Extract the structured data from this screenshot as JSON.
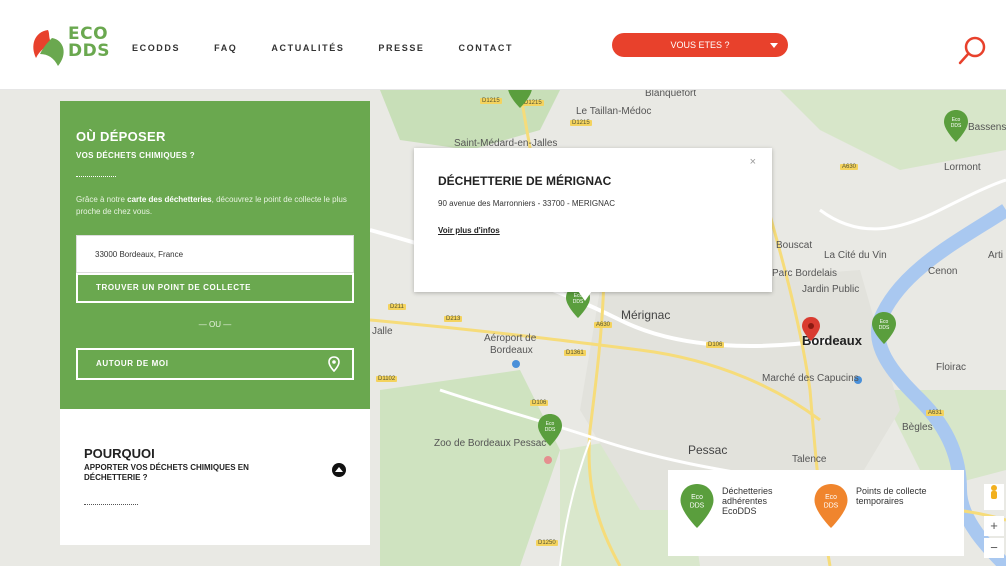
{
  "header": {
    "logo": {
      "line1": "ECO",
      "line2": "DDS",
      "green": "#6aa84f",
      "red": "#e8412c"
    },
    "nav": [
      "ECODDS",
      "FAQ",
      "ACTUALITÉS",
      "PRESSE",
      "CONTACT"
    ],
    "vous_etes": "VOUS ETES ?",
    "search_icon": "search-icon"
  },
  "panel": {
    "title": "OÙ DÉPOSER",
    "subtitle": "VOS DÉCHETS CHIMIQUES ?",
    "desc_before": "Grâce à notre ",
    "desc_bold": "carte des déchetteries",
    "desc_after": ", découvrez le point de collecte le plus proche de chez vous.",
    "address_value": "33000 Bordeaux, France",
    "find_button": "TROUVER UN POINT DE COLLECTE",
    "or_text": "— OU —",
    "near_button": "AUTOUR DE MOI"
  },
  "why": {
    "title": "POURQUOI",
    "subtitle": "APPORTER VOS DÉCHETS CHIMIQUES EN DÉCHETTERIE ?"
  },
  "popup": {
    "title": "DÉCHETTERIE DE MÉRIGNAC",
    "address": "90 avenue des Marronniers - 33700 - MERIGNAC",
    "link": "Voir plus d'infos",
    "close": "×"
  },
  "map": {
    "pin_label_line1": "Eco",
    "pin_label_line2": "DDS",
    "places": {
      "blanquefort": "Blanquefort",
      "taillan": "Le Taillan-Médoc",
      "saint_medard": "Saint-Médard-en-Jalles",
      "merignac": "Mérignac",
      "aeroport1": "Aéroport de",
      "aeroport2": "Bordeaux",
      "zoo": "Zoo de Bordeaux Pessac",
      "pessac": "Pessac",
      "talence": "Talence",
      "bordeaux": "Bordeaux",
      "bouscat": "Bouscat",
      "cite_vin": "La Cité du Vin",
      "parc": "Parc Bordelais",
      "jardin": "Jardin Public",
      "marche": "Marché des Capucins",
      "lormont": "Lormont",
      "cenon": "Cenon",
      "floirac": "Floirac",
      "begles": "Bègles",
      "bassens": "Bassens",
      "arti": "Arti",
      "jalle": "Jalle"
    },
    "roads": [
      "D1215",
      "D1215",
      "D1215",
      "D211",
      "D213",
      "A630",
      "D106",
      "D1361",
      "D106",
      "D1102",
      "D1250",
      "A630",
      "A631"
    ]
  },
  "legend": {
    "item1": "Déchetteries adhérentes EcoDDS",
    "item2": "Points de collecte temporaires",
    "green": "#5a9e3d",
    "orange": "#f0852d"
  },
  "controls": {
    "zoom_in": "+",
    "zoom_out": "−"
  }
}
